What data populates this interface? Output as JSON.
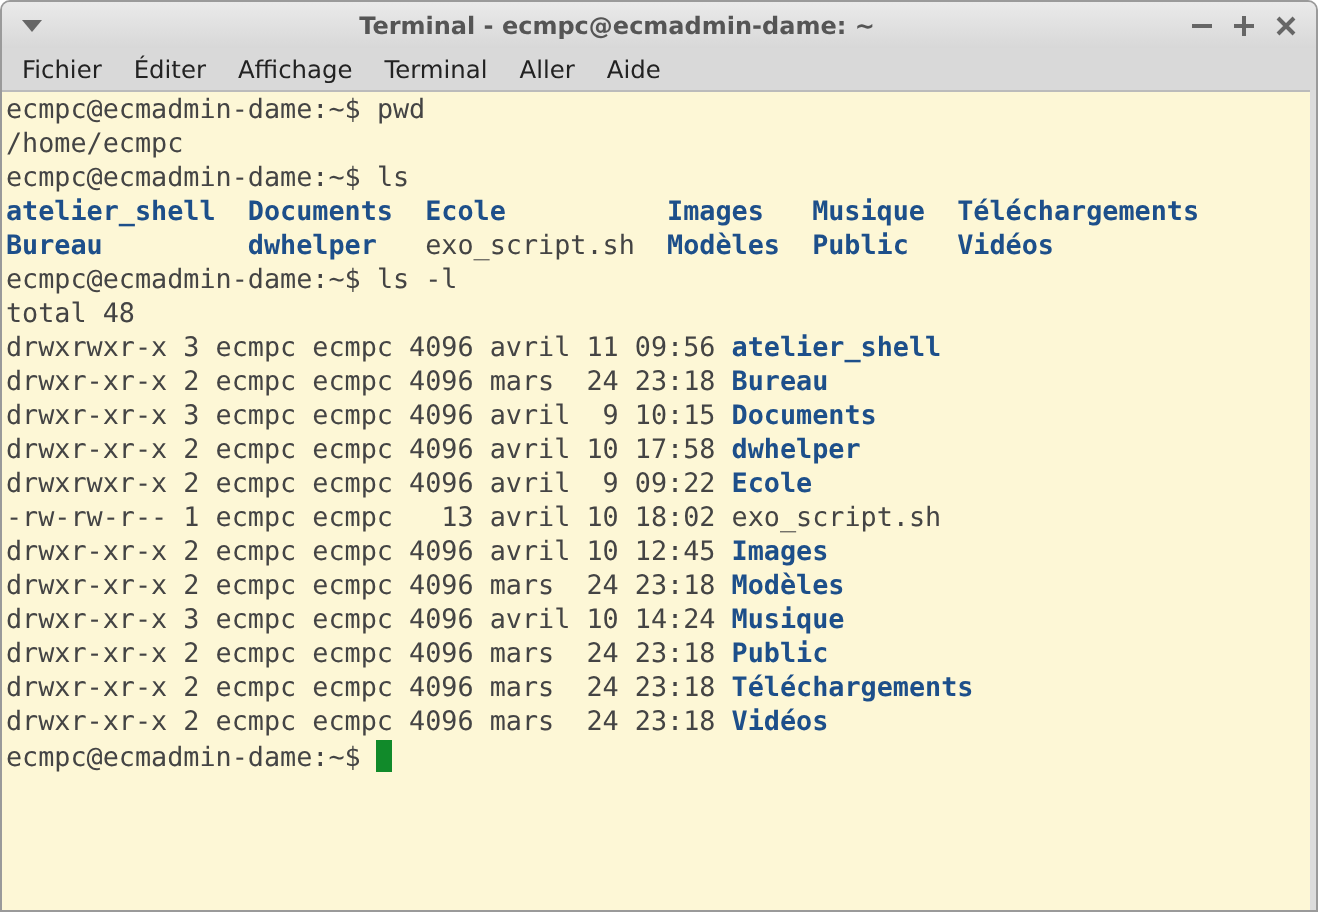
{
  "window": {
    "title": "Terminal - ecmpc@ecmadmin-dame: ~"
  },
  "menu": [
    "Fichier",
    "Éditer",
    "Affichage",
    "Terminal",
    "Aller",
    "Aide"
  ],
  "lines": [
    {
      "kind": "command",
      "prompt": "ecmpc@ecmadmin-dame:~$",
      "command": "pwd"
    },
    {
      "kind": "output",
      "text": "/home/ecmpc"
    },
    {
      "kind": "command",
      "prompt": "ecmpc@ecmadmin-dame:~$",
      "command": "ls"
    },
    {
      "kind": "grid",
      "rows": [
        [
          {
            "name": "atelier_shell",
            "kind": "dir"
          },
          {
            "name": "Documents",
            "kind": "dir"
          },
          {
            "name": "Ecole",
            "kind": "dir"
          },
          {
            "name": "Images",
            "kind": "dir"
          },
          {
            "name": "Musique",
            "kind": "dir"
          },
          {
            "name": "Téléchargements",
            "kind": "dir"
          }
        ],
        [
          {
            "name": "Bureau",
            "kind": "dir"
          },
          {
            "name": "dwhelper",
            "kind": "dir"
          },
          {
            "name": "exo_script.sh",
            "kind": "file"
          },
          {
            "name": "Modèles",
            "kind": "dir"
          },
          {
            "name": "Public",
            "kind": "dir"
          },
          {
            "name": "Vidéos",
            "kind": "dir"
          }
        ]
      ]
    },
    {
      "kind": "command",
      "prompt": "ecmpc@ecmadmin-dame:~$",
      "command": "ls -l"
    },
    {
      "kind": "output",
      "text": "total 48"
    },
    {
      "kind": "long",
      "info": "drwxrwxr-x 3 ecmpc ecmpc 4096 avril 11 09:56",
      "entry": {
        "name": "atelier_shell",
        "kind": "dir"
      }
    },
    {
      "kind": "long",
      "info": "drwxr-xr-x 2 ecmpc ecmpc 4096 mars  24 23:18",
      "entry": {
        "name": "Bureau",
        "kind": "dir"
      }
    },
    {
      "kind": "long",
      "info": "drwxr-xr-x 3 ecmpc ecmpc 4096 avril  9 10:15",
      "entry": {
        "name": "Documents",
        "kind": "dir"
      }
    },
    {
      "kind": "long",
      "info": "drwxr-xr-x 2 ecmpc ecmpc 4096 avril 10 17:58",
      "entry": {
        "name": "dwhelper",
        "kind": "dir"
      }
    },
    {
      "kind": "long",
      "info": "drwxrwxr-x 2 ecmpc ecmpc 4096 avril  9 09:22",
      "entry": {
        "name": "Ecole",
        "kind": "dir"
      }
    },
    {
      "kind": "long",
      "info": "-rw-rw-r-- 1 ecmpc ecmpc   13 avril 10 18:02",
      "entry": {
        "name": "exo_script.sh",
        "kind": "file"
      }
    },
    {
      "kind": "long",
      "info": "drwxr-xr-x 2 ecmpc ecmpc 4096 avril 10 12:45",
      "entry": {
        "name": "Images",
        "kind": "dir"
      }
    },
    {
      "kind": "long",
      "info": "drwxr-xr-x 2 ecmpc ecmpc 4096 mars  24 23:18",
      "entry": {
        "name": "Modèles",
        "kind": "dir"
      }
    },
    {
      "kind": "long",
      "info": "drwxr-xr-x 3 ecmpc ecmpc 4096 avril 10 14:24",
      "entry": {
        "name": "Musique",
        "kind": "dir"
      }
    },
    {
      "kind": "long",
      "info": "drwxr-xr-x 2 ecmpc ecmpc 4096 mars  24 23:18",
      "entry": {
        "name": "Public",
        "kind": "dir"
      }
    },
    {
      "kind": "long",
      "info": "drwxr-xr-x 2 ecmpc ecmpc 4096 mars  24 23:18",
      "entry": {
        "name": "Téléchargements",
        "kind": "dir"
      }
    },
    {
      "kind": "long",
      "info": "drwxr-xr-x 2 ecmpc ecmpc 4096 mars  24 23:18",
      "entry": {
        "name": "Vidéos",
        "kind": "dir"
      }
    },
    {
      "kind": "prompt",
      "prompt": "ecmpc@ecmadmin-dame:~$",
      "cursor": true
    }
  ]
}
